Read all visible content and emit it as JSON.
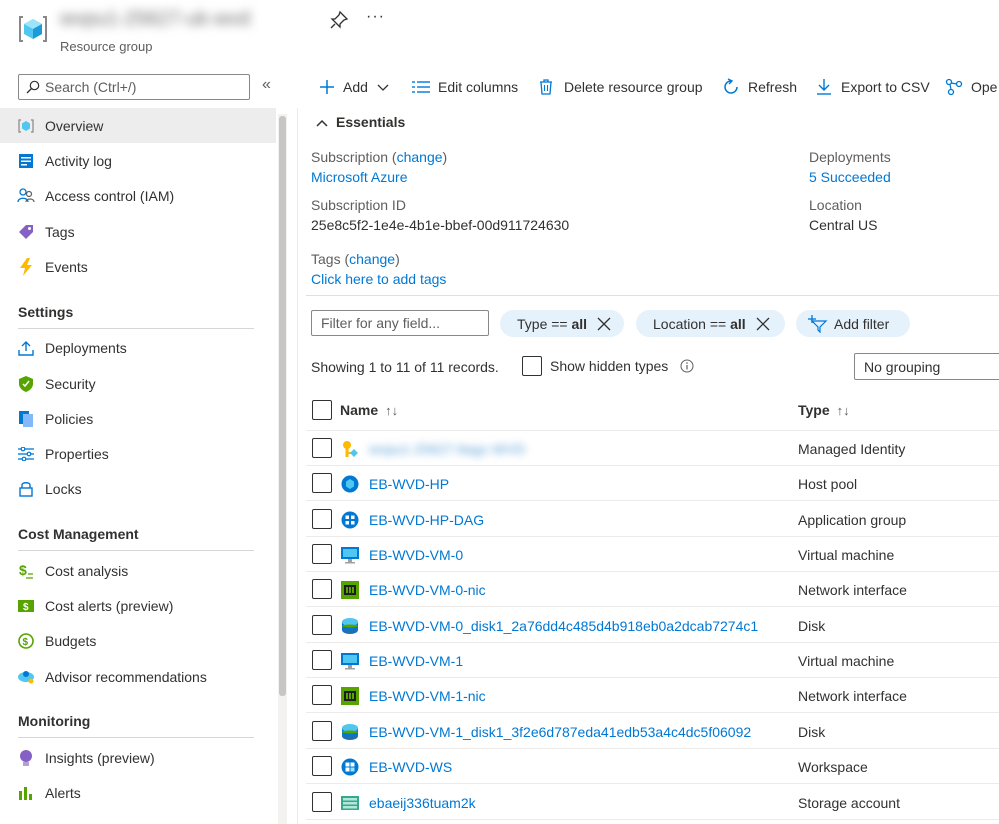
{
  "header": {
    "title": "wvpu1-25627-uk-wvd",
    "subtitle": "Resource group"
  },
  "sidebar": {
    "search_placeholder": "Search (Ctrl+/)",
    "collapse_glyph": "«",
    "items": [
      {
        "label": "Overview",
        "icon": "overview-icon"
      },
      {
        "label": "Activity log",
        "icon": "activity-log-icon"
      },
      {
        "label": "Access control (IAM)",
        "icon": "access-control-icon"
      },
      {
        "label": "Tags",
        "icon": "tag-icon"
      },
      {
        "label": "Events",
        "icon": "events-icon"
      }
    ],
    "settings_title": "Settings",
    "settings": [
      {
        "label": "Deployments",
        "icon": "deployments-icon"
      },
      {
        "label": "Security",
        "icon": "security-icon"
      },
      {
        "label": "Policies",
        "icon": "policies-icon"
      },
      {
        "label": "Properties",
        "icon": "properties-icon"
      },
      {
        "label": "Locks",
        "icon": "lock-icon"
      }
    ],
    "cost_title": "Cost Management",
    "cost": [
      {
        "label": "Cost analysis",
        "icon": "cost-analysis-icon"
      },
      {
        "label": "Cost alerts (preview)",
        "icon": "cost-alerts-icon"
      },
      {
        "label": "Budgets",
        "icon": "budgets-icon"
      },
      {
        "label": "Advisor recommendations",
        "icon": "advisor-icon"
      }
    ],
    "monitoring_title": "Monitoring",
    "monitoring": [
      {
        "label": "Insights (preview)",
        "icon": "insights-icon"
      },
      {
        "label": "Alerts",
        "icon": "alerts-icon"
      }
    ]
  },
  "toolbar": {
    "add": "Add",
    "edit_columns": "Edit columns",
    "delete": "Delete resource group",
    "refresh": "Refresh",
    "export": "Export to CSV",
    "open": "Ope"
  },
  "essentials": {
    "title": "Essentials",
    "subscription_label": "Subscription",
    "change": "change",
    "subscription_value": "Microsoft Azure",
    "subscription_id_label": "Subscription ID",
    "subscription_id_value": "25e8c5f2-1e4e-4b1e-bbef-00d911724630",
    "tags_label": "Tags",
    "tags_value": "Click here to add tags",
    "deployments_label": "Deployments",
    "deployments_value": "5 Succeeded",
    "location_label": "Location",
    "location_value": "Central US"
  },
  "filters": {
    "placeholder": "Filter for any field...",
    "type_label": "Type ==",
    "type_value": "all",
    "location_label": "Location ==",
    "location_value": "all",
    "add_filter": "Add filter",
    "records": "Showing 1 to 11 of 11 records.",
    "show_hidden": "Show hidden types",
    "grouping": "No grouping"
  },
  "table": {
    "col_name": "Name",
    "col_type": "Type",
    "sort_glyph": "↑↓",
    "rows": [
      {
        "name": "wvpu1-25627-ttagc-WVD",
        "type": "Managed Identity",
        "icon": "managed-identity-icon"
      },
      {
        "name": "EB-WVD-HP",
        "type": "Host pool",
        "icon": "host-pool-icon"
      },
      {
        "name": "EB-WVD-HP-DAG",
        "type": "Application group",
        "icon": "application-group-icon"
      },
      {
        "name": "EB-WVD-VM-0",
        "type": "Virtual machine",
        "icon": "virtual-machine-icon"
      },
      {
        "name": "EB-WVD-VM-0-nic",
        "type": "Network interface",
        "icon": "network-interface-icon"
      },
      {
        "name": "EB-WVD-VM-0_disk1_2a76dd4c485d4b918eb0a2dcab7274c1",
        "type": "Disk",
        "icon": "disk-icon"
      },
      {
        "name": "EB-WVD-VM-1",
        "type": "Virtual machine",
        "icon": "virtual-machine-icon"
      },
      {
        "name": "EB-WVD-VM-1-nic",
        "type": "Network interface",
        "icon": "network-interface-icon"
      },
      {
        "name": "EB-WVD-VM-1_disk1_3f2e6d787eda41edb53a4c4dc5f06092",
        "type": "Disk",
        "icon": "disk-icon"
      },
      {
        "name": "EB-WVD-WS",
        "type": "Workspace",
        "icon": "workspace-icon"
      },
      {
        "name": "ebaeij336tuam2k",
        "type": "Storage account",
        "icon": "storage-account-icon"
      }
    ]
  },
  "colors": {
    "accent": "#0078d4",
    "pill_bg": "#e5f1fb",
    "active_nav": "#ededed"
  }
}
